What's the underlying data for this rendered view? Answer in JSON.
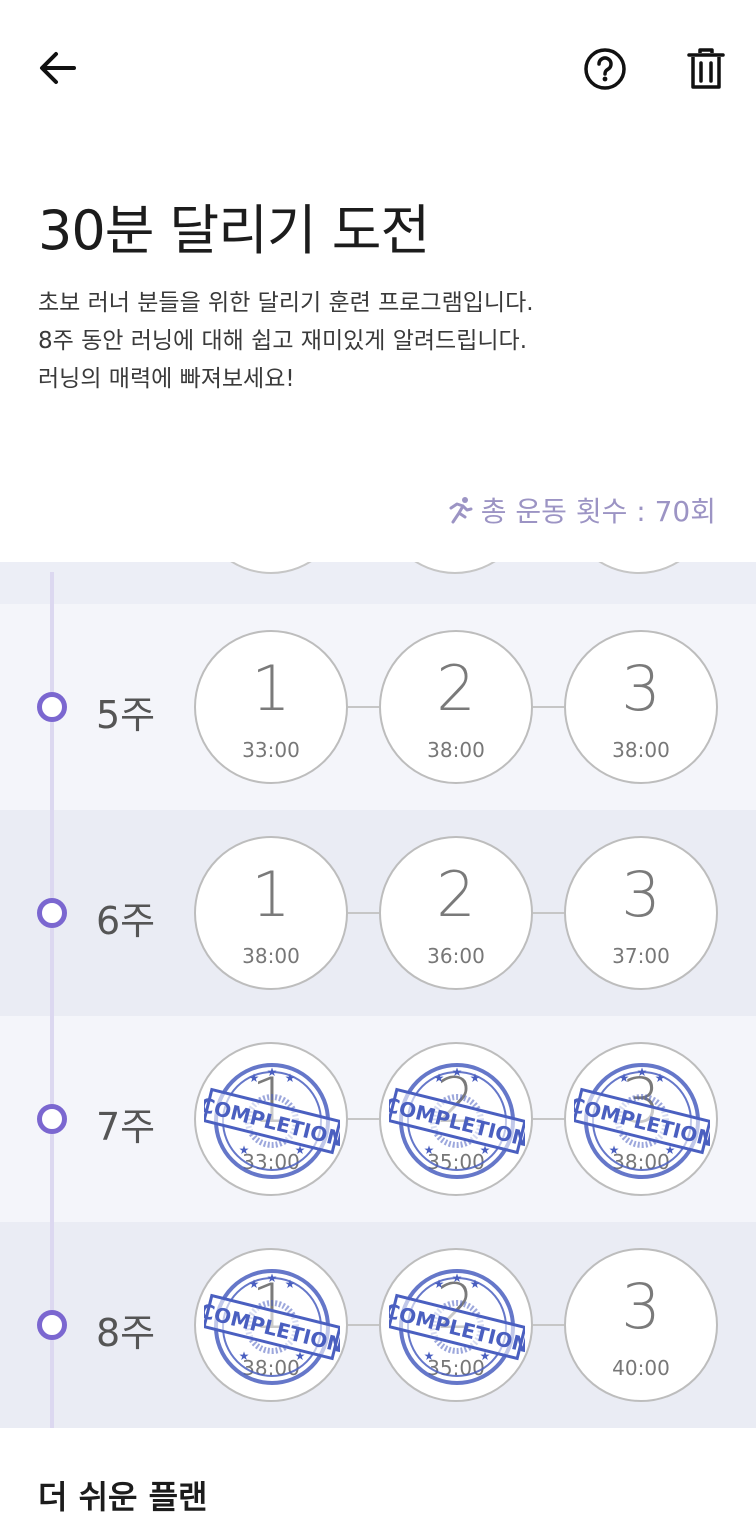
{
  "header": {
    "back_icon": "arrow-left-icon",
    "help_icon": "question-circle-icon",
    "delete_icon": "trash-icon"
  },
  "program": {
    "title": "30분 달리기 도전",
    "description": [
      "초보 러너 분들을 위한 달리기 훈련 프로그램입니다.",
      "8주 동안 러닝에 대해 쉽고 재미있게 알려드립니다.",
      "러닝의 매력에 빠져보세요!"
    ],
    "total_label": "총 운동 횟수 : 70회",
    "total_icon": "running-person-icon"
  },
  "stamp_text": "COMPLETION",
  "weeks": [
    {
      "label": "5주",
      "sessions": [
        {
          "num": "1",
          "time": "33:00",
          "completed": false
        },
        {
          "num": "2",
          "time": "38:00",
          "completed": false
        },
        {
          "num": "3",
          "time": "38:00",
          "completed": false
        }
      ]
    },
    {
      "label": "6주",
      "sessions": [
        {
          "num": "1",
          "time": "38:00",
          "completed": false
        },
        {
          "num": "2",
          "time": "36:00",
          "completed": false
        },
        {
          "num": "3",
          "time": "37:00",
          "completed": false
        }
      ]
    },
    {
      "label": "7주",
      "sessions": [
        {
          "num": "1",
          "time": "33:00",
          "completed": true
        },
        {
          "num": "2",
          "time": "35:00",
          "completed": true
        },
        {
          "num": "3",
          "time": "38:00",
          "completed": true
        }
      ]
    },
    {
      "label": "8주",
      "sessions": [
        {
          "num": "1",
          "time": "38:00",
          "completed": true
        },
        {
          "num": "2",
          "time": "35:00",
          "completed": true
        },
        {
          "num": "3",
          "time": "40:00",
          "completed": false
        }
      ]
    }
  ],
  "easier_plan": {
    "title": "더 쉬운 플랜"
  },
  "colors": {
    "accent": "#7b67d0",
    "stamp": "#4a5fc0",
    "total_text": "#9c94c4"
  }
}
